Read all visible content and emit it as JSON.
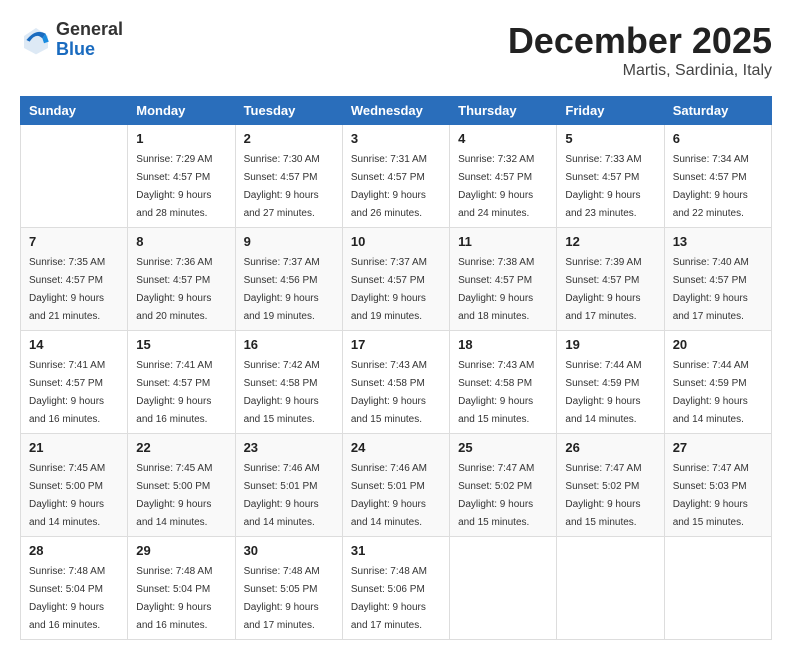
{
  "header": {
    "logo_general": "General",
    "logo_blue": "Blue",
    "month_title": "December 2025",
    "location": "Martis, Sardinia, Italy"
  },
  "columns": [
    "Sunday",
    "Monday",
    "Tuesday",
    "Wednesday",
    "Thursday",
    "Friday",
    "Saturday"
  ],
  "weeks": [
    [
      {
        "day": "",
        "sunrise": "",
        "sunset": "",
        "daylight": ""
      },
      {
        "day": "1",
        "sunrise": "Sunrise: 7:29 AM",
        "sunset": "Sunset: 4:57 PM",
        "daylight": "Daylight: 9 hours and 28 minutes."
      },
      {
        "day": "2",
        "sunrise": "Sunrise: 7:30 AM",
        "sunset": "Sunset: 4:57 PM",
        "daylight": "Daylight: 9 hours and 27 minutes."
      },
      {
        "day": "3",
        "sunrise": "Sunrise: 7:31 AM",
        "sunset": "Sunset: 4:57 PM",
        "daylight": "Daylight: 9 hours and 26 minutes."
      },
      {
        "day": "4",
        "sunrise": "Sunrise: 7:32 AM",
        "sunset": "Sunset: 4:57 PM",
        "daylight": "Daylight: 9 hours and 24 minutes."
      },
      {
        "day": "5",
        "sunrise": "Sunrise: 7:33 AM",
        "sunset": "Sunset: 4:57 PM",
        "daylight": "Daylight: 9 hours and 23 minutes."
      },
      {
        "day": "6",
        "sunrise": "Sunrise: 7:34 AM",
        "sunset": "Sunset: 4:57 PM",
        "daylight": "Daylight: 9 hours and 22 minutes."
      }
    ],
    [
      {
        "day": "7",
        "sunrise": "Sunrise: 7:35 AM",
        "sunset": "Sunset: 4:57 PM",
        "daylight": "Daylight: 9 hours and 21 minutes."
      },
      {
        "day": "8",
        "sunrise": "Sunrise: 7:36 AM",
        "sunset": "Sunset: 4:57 PM",
        "daylight": "Daylight: 9 hours and 20 minutes."
      },
      {
        "day": "9",
        "sunrise": "Sunrise: 7:37 AM",
        "sunset": "Sunset: 4:56 PM",
        "daylight": "Daylight: 9 hours and 19 minutes."
      },
      {
        "day": "10",
        "sunrise": "Sunrise: 7:37 AM",
        "sunset": "Sunset: 4:57 PM",
        "daylight": "Daylight: 9 hours and 19 minutes."
      },
      {
        "day": "11",
        "sunrise": "Sunrise: 7:38 AM",
        "sunset": "Sunset: 4:57 PM",
        "daylight": "Daylight: 9 hours and 18 minutes."
      },
      {
        "day": "12",
        "sunrise": "Sunrise: 7:39 AM",
        "sunset": "Sunset: 4:57 PM",
        "daylight": "Daylight: 9 hours and 17 minutes."
      },
      {
        "day": "13",
        "sunrise": "Sunrise: 7:40 AM",
        "sunset": "Sunset: 4:57 PM",
        "daylight": "Daylight: 9 hours and 17 minutes."
      }
    ],
    [
      {
        "day": "14",
        "sunrise": "Sunrise: 7:41 AM",
        "sunset": "Sunset: 4:57 PM",
        "daylight": "Daylight: 9 hours and 16 minutes."
      },
      {
        "day": "15",
        "sunrise": "Sunrise: 7:41 AM",
        "sunset": "Sunset: 4:57 PM",
        "daylight": "Daylight: 9 hours and 16 minutes."
      },
      {
        "day": "16",
        "sunrise": "Sunrise: 7:42 AM",
        "sunset": "Sunset: 4:58 PM",
        "daylight": "Daylight: 9 hours and 15 minutes."
      },
      {
        "day": "17",
        "sunrise": "Sunrise: 7:43 AM",
        "sunset": "Sunset: 4:58 PM",
        "daylight": "Daylight: 9 hours and 15 minutes."
      },
      {
        "day": "18",
        "sunrise": "Sunrise: 7:43 AM",
        "sunset": "Sunset: 4:58 PM",
        "daylight": "Daylight: 9 hours and 15 minutes."
      },
      {
        "day": "19",
        "sunrise": "Sunrise: 7:44 AM",
        "sunset": "Sunset: 4:59 PM",
        "daylight": "Daylight: 9 hours and 14 minutes."
      },
      {
        "day": "20",
        "sunrise": "Sunrise: 7:44 AM",
        "sunset": "Sunset: 4:59 PM",
        "daylight": "Daylight: 9 hours and 14 minutes."
      }
    ],
    [
      {
        "day": "21",
        "sunrise": "Sunrise: 7:45 AM",
        "sunset": "Sunset: 5:00 PM",
        "daylight": "Daylight: 9 hours and 14 minutes."
      },
      {
        "day": "22",
        "sunrise": "Sunrise: 7:45 AM",
        "sunset": "Sunset: 5:00 PM",
        "daylight": "Daylight: 9 hours and 14 minutes."
      },
      {
        "day": "23",
        "sunrise": "Sunrise: 7:46 AM",
        "sunset": "Sunset: 5:01 PM",
        "daylight": "Daylight: 9 hours and 14 minutes."
      },
      {
        "day": "24",
        "sunrise": "Sunrise: 7:46 AM",
        "sunset": "Sunset: 5:01 PM",
        "daylight": "Daylight: 9 hours and 14 minutes."
      },
      {
        "day": "25",
        "sunrise": "Sunrise: 7:47 AM",
        "sunset": "Sunset: 5:02 PM",
        "daylight": "Daylight: 9 hours and 15 minutes."
      },
      {
        "day": "26",
        "sunrise": "Sunrise: 7:47 AM",
        "sunset": "Sunset: 5:02 PM",
        "daylight": "Daylight: 9 hours and 15 minutes."
      },
      {
        "day": "27",
        "sunrise": "Sunrise: 7:47 AM",
        "sunset": "Sunset: 5:03 PM",
        "daylight": "Daylight: 9 hours and 15 minutes."
      }
    ],
    [
      {
        "day": "28",
        "sunrise": "Sunrise: 7:48 AM",
        "sunset": "Sunset: 5:04 PM",
        "daylight": "Daylight: 9 hours and 16 minutes."
      },
      {
        "day": "29",
        "sunrise": "Sunrise: 7:48 AM",
        "sunset": "Sunset: 5:04 PM",
        "daylight": "Daylight: 9 hours and 16 minutes."
      },
      {
        "day": "30",
        "sunrise": "Sunrise: 7:48 AM",
        "sunset": "Sunset: 5:05 PM",
        "daylight": "Daylight: 9 hours and 17 minutes."
      },
      {
        "day": "31",
        "sunrise": "Sunrise: 7:48 AM",
        "sunset": "Sunset: 5:06 PM",
        "daylight": "Daylight: 9 hours and 17 minutes."
      },
      {
        "day": "",
        "sunrise": "",
        "sunset": "",
        "daylight": ""
      },
      {
        "day": "",
        "sunrise": "",
        "sunset": "",
        "daylight": ""
      },
      {
        "day": "",
        "sunrise": "",
        "sunset": "",
        "daylight": ""
      }
    ]
  ]
}
